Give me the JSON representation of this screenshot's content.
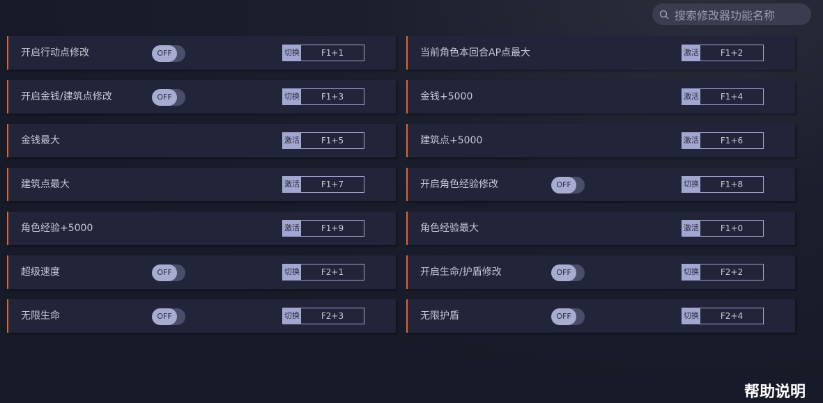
{
  "search": {
    "placeholder": "搜索修改器功能名称"
  },
  "rows": [
    {
      "label": "开启行动点修改",
      "toggle": "OFF",
      "mode": "切换",
      "key": "F1+1"
    },
    {
      "label": "当前角色本回合AP点最大",
      "toggle": "",
      "mode": "激活",
      "key": "F1+2"
    },
    {
      "label": "开启金钱/建筑点修改",
      "toggle": "OFF",
      "mode": "切换",
      "key": "F1+3"
    },
    {
      "label": "金钱+5000",
      "toggle": "",
      "mode": "激活",
      "key": "F1+4"
    },
    {
      "label": "金钱最大",
      "toggle": "",
      "mode": "激活",
      "key": "F1+5"
    },
    {
      "label": "建筑点+5000",
      "toggle": "",
      "mode": "激活",
      "key": "F1+6"
    },
    {
      "label": "建筑点最大",
      "toggle": "",
      "mode": "激活",
      "key": "F1+7"
    },
    {
      "label": "开启角色经验修改",
      "toggle": "OFF",
      "mode": "切换",
      "key": "F1+8"
    },
    {
      "label": "角色经验+5000",
      "toggle": "",
      "mode": "激活",
      "key": "F1+9"
    },
    {
      "label": "角色经验最大",
      "toggle": "",
      "mode": "激活",
      "key": "F1+0"
    },
    {
      "label": "超级速度",
      "toggle": "OFF",
      "mode": "切换",
      "key": "F2+1"
    },
    {
      "label": "开启生命/护盾修改",
      "toggle": "OFF",
      "mode": "切换",
      "key": "F2+2"
    },
    {
      "label": "无限生命",
      "toggle": "OFF",
      "mode": "切换",
      "key": "F2+3"
    },
    {
      "label": "无限护盾",
      "toggle": "OFF",
      "mode": "切换",
      "key": "F2+4"
    }
  ],
  "help": {
    "label": "帮助说明"
  },
  "colors": {
    "accent": "#e2662b",
    "row_bg": "#22253a",
    "toggle_knob": "#a9acd1",
    "page_bg": "#171a28"
  },
  "icons": {
    "search": "search-icon"
  }
}
